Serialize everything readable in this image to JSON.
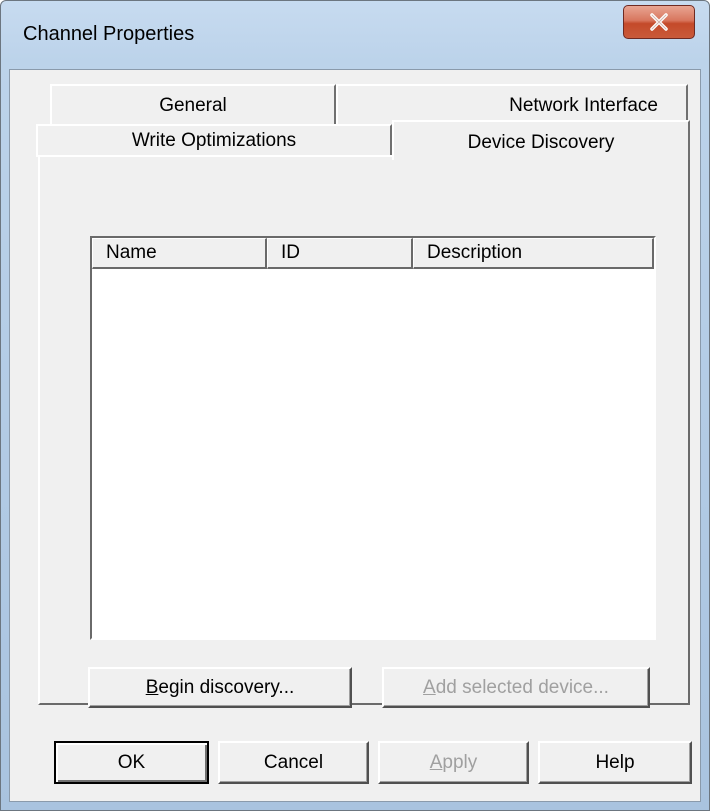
{
  "window": {
    "title": "Channel Properties",
    "close_icon": "close-x-icon"
  },
  "tabs": {
    "row_back": [
      "General",
      "Network Interface"
    ],
    "row_front": [
      "Write Optimizations",
      "Device Discovery"
    ],
    "active": "Device Discovery"
  },
  "device_list": {
    "columns": [
      "Name",
      "ID",
      "Description"
    ],
    "rows": []
  },
  "discovery": {
    "begin_first": "B",
    "begin_rest": "egin discovery...",
    "add_first": "A",
    "add_rest": "dd selected device..."
  },
  "footer": {
    "ok": "OK",
    "cancel": "Cancel",
    "apply_first": "A",
    "apply_rest": "pply",
    "help": "Help"
  },
  "colors": {
    "face": "#f0f0f0",
    "close_button": "#c44a2a",
    "disabled_text": "#a0a0a0"
  }
}
